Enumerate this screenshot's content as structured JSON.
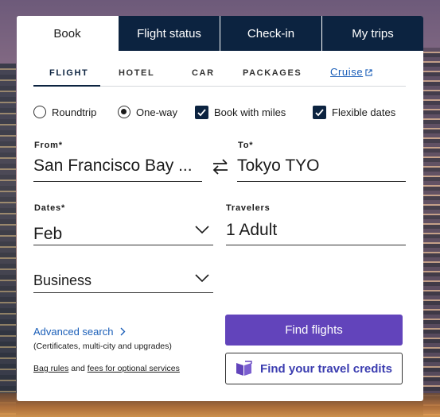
{
  "tabs": [
    {
      "label": "Book",
      "active": true
    },
    {
      "label": "Flight status",
      "active": false
    },
    {
      "label": "Check-in",
      "active": false
    },
    {
      "label": "My trips",
      "active": false
    }
  ],
  "subtabs": [
    {
      "label": "FLIGHT",
      "active": true
    },
    {
      "label": "HOTEL",
      "active": false
    },
    {
      "label": "CAR",
      "active": false
    },
    {
      "label": "PACKAGES",
      "active": false
    }
  ],
  "cruise_link": {
    "label": "Cruise",
    "icon": "external-link-icon"
  },
  "trip_type": {
    "roundtrip_label": "Roundtrip",
    "oneway_label": "One-way",
    "selected": "One-way"
  },
  "options": {
    "book_with_miles": {
      "label": "Book with miles",
      "checked": true
    },
    "flexible_dates": {
      "label": "Flexible dates",
      "checked": true
    }
  },
  "from": {
    "label": "From*",
    "value": "San Francisco Bay ..."
  },
  "to": {
    "label": "To*",
    "value": "Tokyo TYO"
  },
  "dates": {
    "label": "Dates*",
    "value": "Feb"
  },
  "travelers": {
    "label": "Travelers",
    "value": "1 Adult"
  },
  "cabin": {
    "value": "Business"
  },
  "advanced_search": {
    "label": "Advanced search",
    "note": "(Certificates, multi-city and upgrades)"
  },
  "bag_rules": {
    "link1": "Bag rules",
    "connector": "and",
    "link2": "fees for optional services"
  },
  "find_flights_label": "Find flights",
  "travel_credits_label": "Find your travel credits",
  "colors": {
    "navy": "#0c2340",
    "purple": "#6244bb",
    "link": "#1a5eb8"
  }
}
